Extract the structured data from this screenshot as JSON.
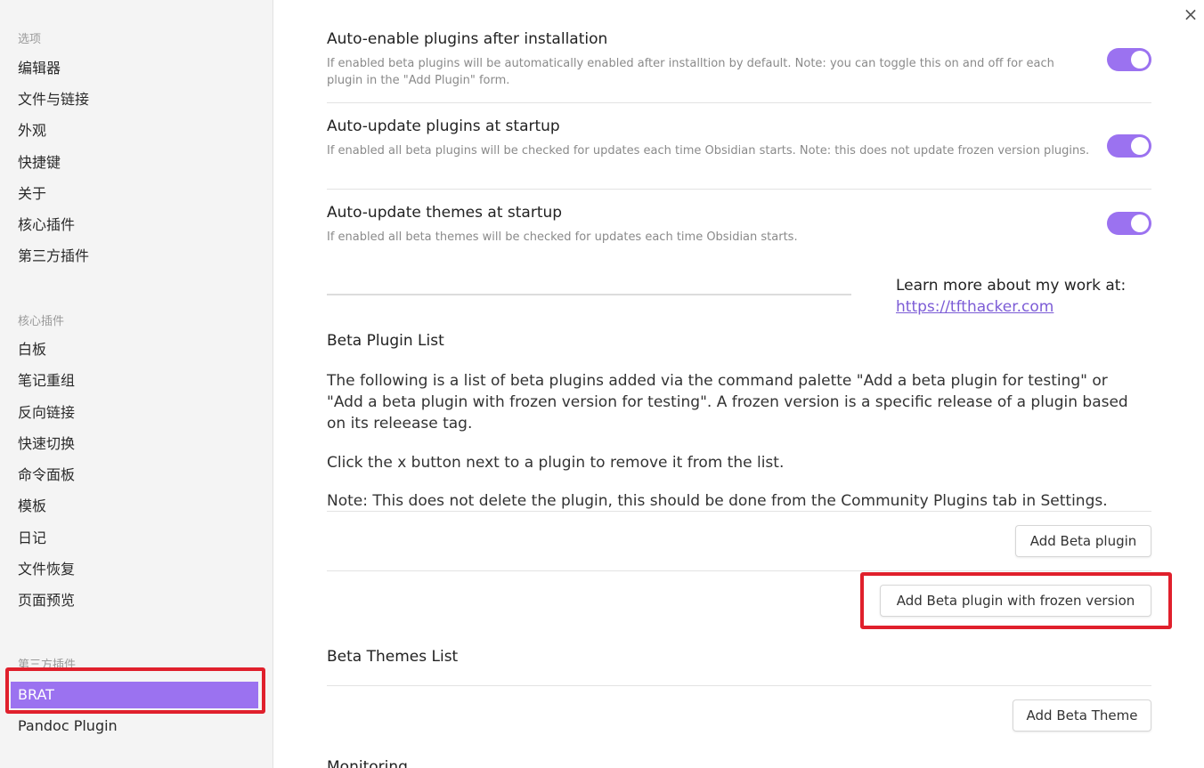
{
  "sidebar": {
    "section_options": "选项",
    "options": [
      "编辑器",
      "文件与链接",
      "外观",
      "快捷键",
      "关于",
      "核心插件",
      "第三方插件"
    ],
    "section_core": "核心插件",
    "core": [
      "白板",
      "笔记重组",
      "反向链接",
      "快速切换",
      "命令面板",
      "模板",
      "日记",
      "文件恢复",
      "页面预览"
    ],
    "section_third": "第三方插件",
    "third": [
      "BRAT",
      "Pandoc Plugin"
    ],
    "active_item": "BRAT"
  },
  "close_icon": "×",
  "settings": [
    {
      "name": "Auto-enable plugins after installation",
      "desc": "If enabled beta plugins will be automatically enabled after installtion by default. Note: you can toggle this on and off for each plugin in the \"Add Plugin\" form.",
      "enabled": true
    },
    {
      "name": "Auto-update plugins at startup",
      "desc": "If enabled all beta plugins will be checked for updates each time Obsidian starts. Note: this does not update frozen version plugins.",
      "enabled": true
    },
    {
      "name": "Auto-update themes at startup",
      "desc": "If enabled all beta themes will be checked for updates each time Obsidian starts.",
      "enabled": true
    }
  ],
  "promo": {
    "text": "Learn more about my work at:",
    "link": "https://tfthacker.com"
  },
  "beta_plugins": {
    "heading": "Beta Plugin List",
    "intro": "The following is a list of beta plugins added via the command palette \"Add a beta plugin for testing\" or \"Add a beta plugin with frozen version for testing\". A frozen version is a specific release of a plugin based on its releease tag.",
    "remove_hint": "Click the x button next to a plugin to remove it from the list.",
    "note_label": "Note:",
    "note_text": "This does not delete the plugin, this should be done from the Community Plugins tab in Settings.",
    "add_button": "Add Beta plugin",
    "add_frozen_button": "Add Beta plugin with frozen version"
  },
  "beta_themes": {
    "heading": "Beta Themes List",
    "add_button": "Add Beta Theme"
  },
  "next_heading": "Monitoring",
  "colors": {
    "accent": "#9b72f0",
    "highlight": "#e0202c"
  }
}
